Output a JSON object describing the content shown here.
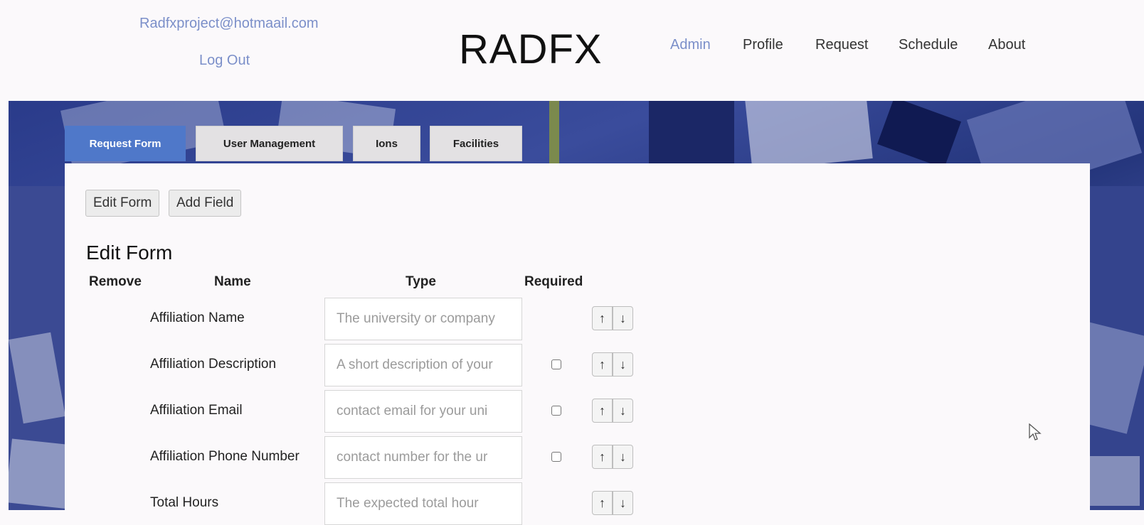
{
  "header": {
    "email": "Radfxproject@hotmaail.com",
    "logout_label": "Log Out",
    "brand": "RADFX",
    "nav": [
      {
        "label": "Admin",
        "active": true
      },
      {
        "label": "Profile",
        "active": false
      },
      {
        "label": "Request",
        "active": false
      },
      {
        "label": "Schedule",
        "active": false
      },
      {
        "label": "About",
        "active": false
      }
    ]
  },
  "tabs": [
    {
      "label": "Request Form",
      "active": true
    },
    {
      "label": "User Management",
      "active": false
    },
    {
      "label": "Ions",
      "active": false
    },
    {
      "label": "Facilities",
      "active": false
    }
  ],
  "toolbar": {
    "edit_form_label": "Edit Form",
    "add_field_label": "Add Field"
  },
  "form_editor": {
    "title": "Edit Form",
    "columns": [
      "Remove",
      "Name",
      "Type",
      "Required"
    ],
    "rows": [
      {
        "name": "Affiliation Name",
        "type_placeholder": "The university or company",
        "required_checkbox": false
      },
      {
        "name": "Affiliation Description",
        "type_placeholder": "A short description of your",
        "required_checkbox": true
      },
      {
        "name": "Affiliation Email",
        "type_placeholder": "contact email for your uni",
        "required_checkbox": true
      },
      {
        "name": "Affiliation Phone Number",
        "type_placeholder": "contact number for the ur",
        "required_checkbox": true
      },
      {
        "name": "Total Hours",
        "type_placeholder": "The expected total hour",
        "required_checkbox": false
      }
    ],
    "move_up_glyph": "↑",
    "move_down_glyph": "↓"
  },
  "colors": {
    "accent": "#4f78c9",
    "link": "#7b8fc9",
    "page_bg": "#fbf9fb"
  }
}
